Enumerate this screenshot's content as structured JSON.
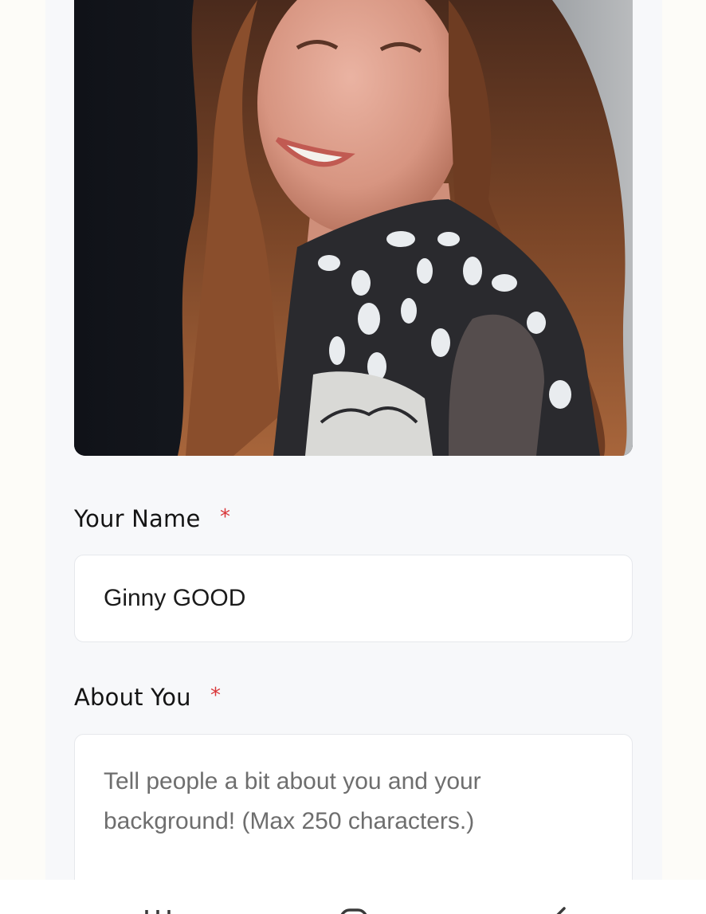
{
  "profile": {
    "photo_alt": "Profile photo"
  },
  "form": {
    "name": {
      "label": "Your Name",
      "required_mark": "*",
      "value": "Ginny GOOD"
    },
    "about": {
      "label": "About You",
      "required_mark": "*",
      "value": "",
      "placeholder": "Tell people a bit about you and your background! (Max 250 characters.)"
    }
  },
  "navbar": {
    "recents_icon": "recents-icon",
    "home_icon": "home-icon",
    "back_icon": "back-icon"
  },
  "colors": {
    "required": "#d9373a",
    "panel_bg": "#f7f8fa",
    "page_bg": "#fdfcf8"
  }
}
